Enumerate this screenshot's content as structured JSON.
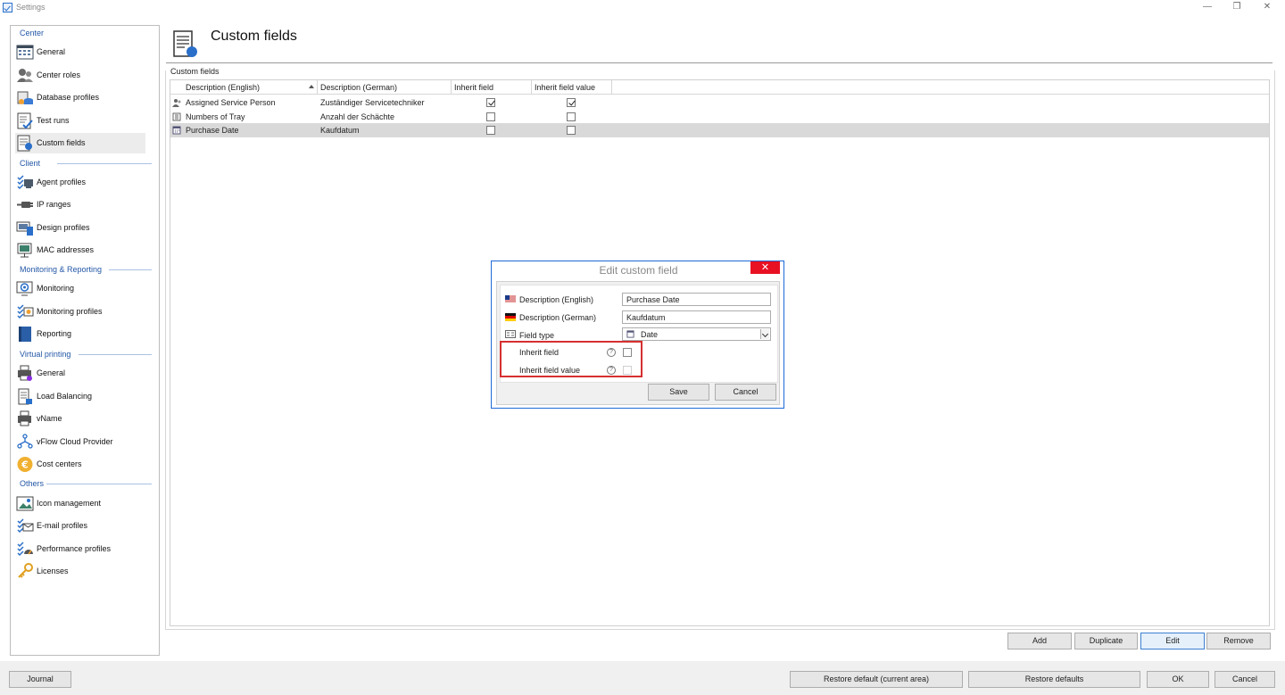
{
  "window": {
    "title": "Settings",
    "minimize": "—",
    "restore": "❐",
    "close": "✕"
  },
  "sidebar": {
    "sections": [
      {
        "header": "Center",
        "items": [
          {
            "label": "General",
            "icon": "grid-icon"
          },
          {
            "label": "Center roles",
            "icon": "users-icon"
          },
          {
            "label": "Database profiles",
            "icon": "database-icon"
          },
          {
            "label": "Test runs",
            "icon": "test-runs-icon"
          },
          {
            "label": "Custom fields",
            "icon": "custom-fields-icon",
            "active": true
          }
        ]
      },
      {
        "header": "Client",
        "items": [
          {
            "label": "Agent profiles",
            "icon": "agent-profiles-icon"
          },
          {
            "label": "IP ranges",
            "icon": "ip-ranges-icon"
          },
          {
            "label": "Design profiles",
            "icon": "design-profiles-icon"
          },
          {
            "label": "MAC addresses",
            "icon": "mac-addresses-icon"
          }
        ]
      },
      {
        "header": "Monitoring & Reporting",
        "items": [
          {
            "label": "Monitoring",
            "icon": "monitoring-icon"
          },
          {
            "label": "Monitoring profiles",
            "icon": "monitoring-profiles-icon"
          },
          {
            "label": "Reporting",
            "icon": "reporting-icon"
          }
        ]
      },
      {
        "header": "Virtual printing",
        "items": [
          {
            "label": "General",
            "icon": "printer-icon"
          },
          {
            "label": "Load Balancing",
            "icon": "load-balancing-icon"
          },
          {
            "label": "vName",
            "icon": "vname-icon"
          },
          {
            "label": "vFlow Cloud Provider",
            "icon": "vflow-icon"
          },
          {
            "label": "Cost centers",
            "icon": "euro-icon"
          }
        ]
      },
      {
        "header": "Others",
        "items": [
          {
            "label": "Icon management",
            "icon": "icon-management-icon"
          },
          {
            "label": "E-mail profiles",
            "icon": "email-profiles-icon"
          },
          {
            "label": "Performance profiles",
            "icon": "performance-profiles-icon"
          },
          {
            "label": "Licenses",
            "icon": "key-icon"
          }
        ]
      }
    ]
  },
  "main": {
    "title": "Custom fields",
    "group_label": "Custom fields",
    "columns": [
      "Description (English)",
      "Description (German)",
      "Inherit field",
      "Inherit field value"
    ],
    "rows": [
      {
        "icon": "person-icon",
        "english": "Assigned Service Person",
        "german": "Zuständiger Servicetechniker",
        "inherit_field": true,
        "inherit_value": true
      },
      {
        "icon": "number-icon",
        "english": "Numbers of Tray",
        "german": "Anzahl der Schächte",
        "inherit_field": false,
        "inherit_value": false
      },
      {
        "icon": "calendar-icon",
        "english": "Purchase Date",
        "german": "Kaufdatum",
        "inherit_field": false,
        "inherit_value": false,
        "selected": true
      }
    ],
    "buttons": {
      "add": "Add",
      "duplicate": "Duplicate",
      "edit": "Edit",
      "remove": "Remove"
    }
  },
  "dialog": {
    "title": "Edit custom field",
    "close": "✕",
    "desc_en_label": "Description (English)",
    "desc_en_value": "Purchase Date",
    "desc_de_label": "Description (German)",
    "desc_de_value": "Kaufdatum",
    "field_type_label": "Field type",
    "field_type_value": "Date",
    "inherit_field_label": "Inherit field",
    "inherit_value_label": "Inherit field value",
    "help_glyph": "?",
    "save": "Save",
    "cancel": "Cancel"
  },
  "footer": {
    "journal": "Journal",
    "restore_current": "Restore default (current area)",
    "restore_defaults": "Restore defaults",
    "ok": "OK",
    "cancel": "Cancel"
  },
  "colors": {
    "accent": "#2357a6",
    "highlight": "#d62f2f",
    "dialog_border": "#1c6ad7"
  }
}
